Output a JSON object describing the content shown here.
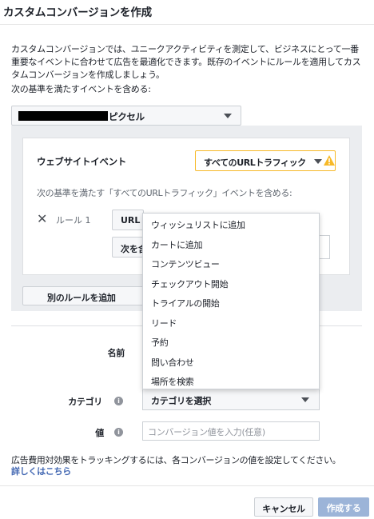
{
  "dialog": {
    "title": "カスタムコンバージョンを作成",
    "description": "カスタムコンバージョンでは、ユニークアクティビティを測定して、ビジネスにとって一番重要なイベントに合わせて広告を最適化できます。既存のイベントにルールを適用してカスタムコンバージョンを作成しましょう。",
    "criteria_label": "次の基準を満たすイベントを含める:"
  },
  "pixel_select": {
    "value_suffix": "ピクセル",
    "caret_icon": "caret-down-icon"
  },
  "rule_panel": {
    "event_label": "ウェブサイトイベント",
    "event_select": "すべてのURLトラフィック",
    "warning_icon": "warning-icon",
    "rule_desc": "次の基準を満たす「すべてのURLトラフィック」イベントを含める:",
    "rule_name": "ルール 1",
    "url_chip": "URL",
    "next_chip": "次を含む",
    "add_rule_button": "別のルールを追加"
  },
  "dropdown_items": [
    "ウィッシュリストに追加",
    "カートに追加",
    "コンテンツビュー",
    "チェックアウト開始",
    "トライアルの開始",
    "リード",
    "予約",
    "問い合わせ",
    "場所を検索"
  ],
  "form": {
    "name_label": "名前",
    "category_label": "カテゴリ",
    "category_placeholder": "カテゴリを選択",
    "value_label": "値",
    "value_placeholder": "コンバージョン値を入力(任意)",
    "info_icon": "info-icon"
  },
  "footer": {
    "note": "広告費用対効果をトラッキングするには、各コンバージョンの値を設定してください。",
    "learn_more": "詳しくはこちら",
    "cancel_button": "キャンセル",
    "create_button": "作成する"
  },
  "colors": {
    "warning_border": "#f7b928",
    "link": "#4267b2",
    "primary_disabled": "#9cb4d8"
  }
}
